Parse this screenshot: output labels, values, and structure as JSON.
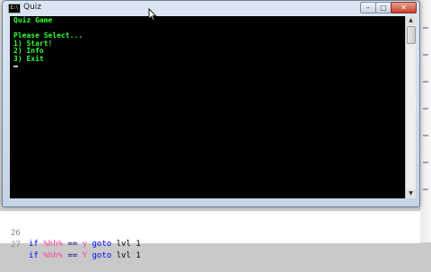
{
  "window": {
    "title": "Quiz",
    "icon_label": "C:\\",
    "controls": {
      "minimize": "–",
      "maximize": "□",
      "close": "✕"
    }
  },
  "console": {
    "lines": [
      "Quiz Game",
      "",
      "Please Select...",
      "1) Start!",
      "2) Info",
      "3) Exit"
    ],
    "text_color": "#33ff33",
    "background": "#000000"
  },
  "editor": {
    "lines": [
      {
        "number": "26",
        "kw1": "if",
        "var": "%hh%",
        "op": "==",
        "value": "y",
        "kw2": "goto",
        "target": "lvl 1"
      },
      {
        "number": "27",
        "kw1": "if",
        "var": "%hh%",
        "op": "==",
        "value": "Y",
        "kw2": "goto",
        "target": "lvl 1"
      }
    ]
  },
  "scrollbar": {
    "up": "▲",
    "down": "▼"
  }
}
